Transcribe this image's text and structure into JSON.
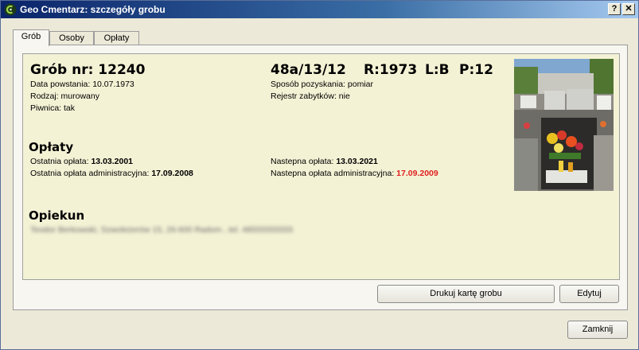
{
  "window": {
    "title": "Geo Cmentarz: szczegóły grobu",
    "help_label": "?",
    "close_label": "✕"
  },
  "tabs": [
    {
      "label": "Grób"
    },
    {
      "label": "Osoby"
    },
    {
      "label": "Opłaty"
    }
  ],
  "grave": {
    "number_label": "Grób nr: 12240",
    "location": "48a/13/12",
    "row": "R:1973",
    "l": "L:B",
    "p": "P:12",
    "created": "Data powstania: 10.07.1973",
    "type": "Rodzaj: murowany",
    "cellar": "Piwnica: tak",
    "acquisition": "Sposób pozyskania: pomiar",
    "monument_register": "Rejestr zabytków: nie"
  },
  "fees": {
    "heading": "Opłaty",
    "last_fee_label": "Ostatnia opłata: ",
    "last_fee_value": "13.03.2001",
    "last_admin_label": "Ostatnia opłata administracyjna: ",
    "last_admin_value": "17.09.2008",
    "next_fee_label": "Nastepna opłata: ",
    "next_fee_value": "13.03.2021",
    "next_admin_label": "Nastepna opłata administracyjna: ",
    "next_admin_value": "17.09.2009"
  },
  "caretaker": {
    "heading": "Opiekun",
    "details": "Teodor Berkowski, Szwoleżerów 15, 26-600 Radom , tel. 48555555555"
  },
  "buttons": {
    "print": "Drukuj kartę grobu",
    "edit": "Edytuj",
    "close": "Zamknij"
  },
  "colors": {
    "overdue": "#e02020",
    "card_bg": "#f4f2d5",
    "title_bar": "#0a246a"
  }
}
